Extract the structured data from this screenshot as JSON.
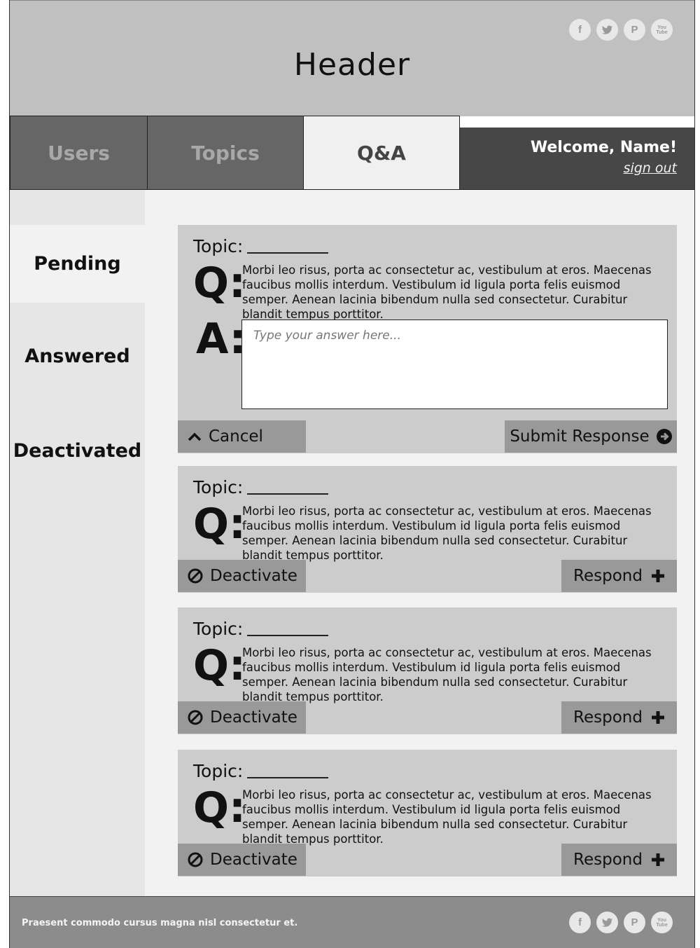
{
  "header": {
    "title": "Header",
    "social_icons": [
      "facebook-icon",
      "twitter-icon",
      "pinterest-icon",
      "youtube-icon"
    ]
  },
  "nav": {
    "tabs": [
      {
        "label": "Users",
        "active": false
      },
      {
        "label": "Topics",
        "active": false
      },
      {
        "label": "Q&A",
        "active": true
      }
    ],
    "welcome": "Welcome, Name!",
    "sign_out": "sign out"
  },
  "sidebar": {
    "items": [
      {
        "label": "Pending",
        "active": true
      },
      {
        "label": "Answered",
        "active": false
      },
      {
        "label": "Deactivated",
        "active": false
      }
    ]
  },
  "cards": [
    {
      "topic_label": "Topic:",
      "q_label": "Q:",
      "question": "Morbi leo risus, porta ac consectetur ac, vestibulum at eros. Maecenas faucibus mollis interdum. Vestibulum id ligula porta felis euismod semper. Aenean lacinia bibendum nulla sed consectetur. Curabitur blandit tempus porttitor.",
      "a_label": "A:",
      "answer_placeholder": "Type your answer here...",
      "cancel_label": "Cancel",
      "submit_label": "Submit Response"
    },
    {
      "topic_label": "Topic:",
      "q_label": "Q:",
      "question": "Morbi leo risus, porta ac consectetur ac, vestibulum at eros. Maecenas faucibus mollis interdum. Vestibulum id ligula porta felis euismod semper. Aenean lacinia bibendum nulla sed consectetur. Curabitur blandit tempus porttitor.",
      "deactivate_label": "Deactivate",
      "respond_label": "Respond"
    },
    {
      "topic_label": "Topic:",
      "q_label": "Q:",
      "question": "Morbi leo risus, porta ac consectetur ac, vestibulum at eros. Maecenas faucibus mollis interdum. Vestibulum id ligula porta felis euismod semper. Aenean lacinia bibendum nulla sed consectetur. Curabitur blandit tempus porttitor.",
      "deactivate_label": "Deactivate",
      "respond_label": "Respond"
    },
    {
      "topic_label": "Topic:",
      "q_label": "Q:",
      "question": "Morbi leo risus, porta ac consectetur ac, vestibulum at eros. Maecenas faucibus mollis interdum. Vestibulum id ligula porta felis euismod semper. Aenean lacinia bibendum nulla sed consectetur. Curabitur blandit tempus porttitor.",
      "deactivate_label": "Deactivate",
      "respond_label": "Respond"
    }
  ],
  "footer": {
    "text": "Praesent commodo cursus magna nisl consectetur et.",
    "social_icons": [
      "facebook-icon",
      "twitter-icon",
      "pinterest-icon",
      "youtube-icon"
    ]
  },
  "colors": {
    "header_bg": "#c0c0c0",
    "tab_inactive_bg": "#666666",
    "tab_active_bg": "#f0f0f0",
    "welcome_bg": "#474747",
    "card_bg": "#cccccc",
    "button_bg": "#999999",
    "footer_bg": "#8c8c8c"
  }
}
